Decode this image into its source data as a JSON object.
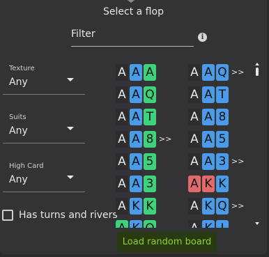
{
  "dialog": {
    "title": "Select a flop",
    "filter_label": "Filter",
    "info_icon": "info-icon",
    "random_button": "Load random board"
  },
  "filters": [
    {
      "label": "Texture",
      "value": "Any"
    },
    {
      "label": "Suits",
      "value": "Any"
    },
    {
      "label": "High Card",
      "value": "Any"
    }
  ],
  "checkbox": {
    "label": "Has turns and rivers",
    "checked": false
  },
  "suit_colors": {
    "s": "#2d2d2d",
    "h": "#e26a6a",
    "d": "#4a9be8",
    "c": "#3ed37a"
  },
  "boards": {
    "left": [
      {
        "cards": [
          {
            "r": "A",
            "s": "s"
          },
          {
            "r": "A",
            "s": "d"
          },
          {
            "r": "A",
            "s": "c"
          }
        ],
        "more": ""
      },
      {
        "cards": [
          {
            "r": "A",
            "s": "s"
          },
          {
            "r": "A",
            "s": "d"
          },
          {
            "r": "Q",
            "s": "c"
          }
        ],
        "more": ""
      },
      {
        "cards": [
          {
            "r": "A",
            "s": "s"
          },
          {
            "r": "A",
            "s": "d"
          },
          {
            "r": "T",
            "s": "c"
          }
        ],
        "more": ""
      },
      {
        "cards": [
          {
            "r": "A",
            "s": "s"
          },
          {
            "r": "A",
            "s": "d"
          },
          {
            "r": "8",
            "s": "c"
          }
        ],
        "more": ">>"
      },
      {
        "cards": [
          {
            "r": "A",
            "s": "s"
          },
          {
            "r": "A",
            "s": "d"
          },
          {
            "r": "5",
            "s": "c"
          }
        ],
        "more": ""
      },
      {
        "cards": [
          {
            "r": "A",
            "s": "s"
          },
          {
            "r": "A",
            "s": "d"
          },
          {
            "r": "3",
            "s": "c"
          }
        ],
        "more": ""
      },
      {
        "cards": [
          {
            "r": "A",
            "s": "s"
          },
          {
            "r": "K",
            "s": "d"
          },
          {
            "r": "K",
            "s": "c"
          }
        ],
        "more": ""
      },
      {
        "cards": [
          {
            "r": "A",
            "s": "c"
          },
          {
            "r": "K",
            "s": "d"
          },
          {
            "r": "Q",
            "s": "c"
          }
        ],
        "more": ""
      }
    ],
    "right": [
      {
        "cards": [
          {
            "r": "A",
            "s": "s"
          },
          {
            "r": "A",
            "s": "d"
          },
          {
            "r": "Q",
            "s": "d"
          }
        ],
        "more": ">>"
      },
      {
        "cards": [
          {
            "r": "A",
            "s": "s"
          },
          {
            "r": "A",
            "s": "d"
          },
          {
            "r": "T",
            "s": "d"
          }
        ],
        "more": ""
      },
      {
        "cards": [
          {
            "r": "A",
            "s": "s"
          },
          {
            "r": "A",
            "s": "d"
          },
          {
            "r": "8",
            "s": "d"
          }
        ],
        "more": ""
      },
      {
        "cards": [
          {
            "r": "A",
            "s": "s"
          },
          {
            "r": "A",
            "s": "d"
          },
          {
            "r": "5",
            "s": "d"
          }
        ],
        "more": ""
      },
      {
        "cards": [
          {
            "r": "A",
            "s": "s"
          },
          {
            "r": "A",
            "s": "d"
          },
          {
            "r": "3",
            "s": "d"
          }
        ],
        "more": ">>"
      },
      {
        "cards": [
          {
            "r": "A",
            "s": "h"
          },
          {
            "r": "K",
            "s": "h"
          },
          {
            "r": "K",
            "s": "d"
          }
        ],
        "more": ""
      },
      {
        "cards": [
          {
            "r": "A",
            "s": "s"
          },
          {
            "r": "K",
            "s": "d"
          },
          {
            "r": "Q",
            "s": "d"
          }
        ],
        "more": ">>"
      },
      {
        "cards": [
          {
            "r": "A",
            "s": "s"
          },
          {
            "r": "K",
            "s": "d"
          },
          {
            "r": "J",
            "s": "d"
          }
        ],
        "more": ""
      }
    ]
  }
}
